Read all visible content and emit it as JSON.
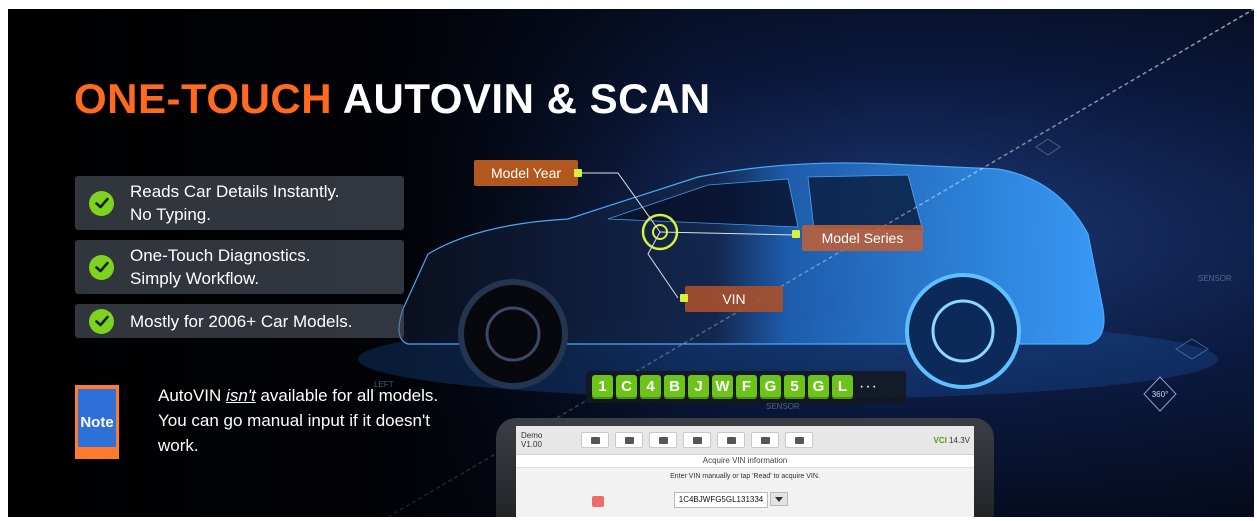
{
  "headline": {
    "part1": "ONE-TOUCH",
    "part2": "AUTOVIN & SCAN"
  },
  "features": [
    {
      "line1": "Reads Car Details Instantly.",
      "line2": "No Typing."
    },
    {
      "line1": "One-Touch Diagnostics.",
      "line2": "Simply Workflow."
    },
    {
      "line1": "Mostly for 2006+ Car Models.",
      "line2": ""
    }
  ],
  "note": {
    "badge": "Note",
    "text_before": "AutoVIN ",
    "text_em": "isn't",
    "text_after": " available for all models. You can go manual input if it doesn't work."
  },
  "callouts": {
    "model_year": "Model Year",
    "model_series": "Model Series",
    "vin": "VIN"
  },
  "vin_chars": [
    "1",
    "C",
    "4",
    "B",
    "J",
    "W",
    "F",
    "G",
    "5",
    "G",
    "L"
  ],
  "vin_more": "···",
  "labels": {
    "sensor_right": "SENSOR",
    "sensor_bottom": "SENSOR",
    "left": "LEFT",
    "deg": "360°"
  },
  "device": {
    "demo_label": "Demo",
    "demo_sub": "V1.00",
    "status": "14.3V",
    "status_brand": "VCI",
    "title": "Acquire VIN information",
    "hint": "Enter VIN manually or tap 'Read' to acquire VIN.",
    "vin_value": "1C4BJWFG5GL131334"
  },
  "colors": {
    "accent_orange": "#ff6a1f",
    "check_green": "#7ed321",
    "vin_green": "#6cc41a",
    "callout": "#b2571e",
    "dot": "#d6f23a"
  }
}
